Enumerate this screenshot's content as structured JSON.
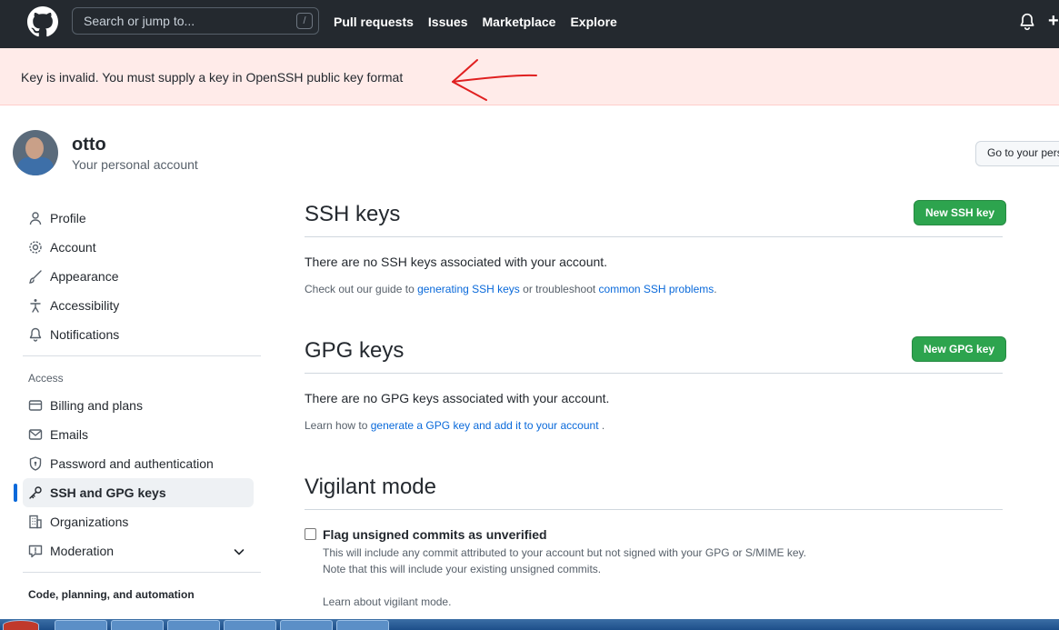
{
  "header": {
    "search_placeholder": "Search or jump to...",
    "slash_hint": "/",
    "nav": [
      "Pull requests",
      "Issues",
      "Marketplace",
      "Explore"
    ],
    "plus": "+"
  },
  "flash": {
    "message": "Key is invalid. You must supply a key in OpenSSH public key format",
    "annotation_color": "#e02020"
  },
  "profile": {
    "username": "otto",
    "subtitle": "Your personal account",
    "goto_button": "Go to your personal profile"
  },
  "sidebar": {
    "items": [
      {
        "label": "Profile",
        "icon": "person-icon"
      },
      {
        "label": "Account",
        "icon": "gear-icon"
      },
      {
        "label": "Appearance",
        "icon": "paintbrush-icon"
      },
      {
        "label": "Accessibility",
        "icon": "accessibility-icon"
      },
      {
        "label": "Notifications",
        "icon": "bell-icon"
      }
    ],
    "access_heading": "Access",
    "access_items": [
      {
        "label": "Billing and plans",
        "icon": "credit-card-icon"
      },
      {
        "label": "Emails",
        "icon": "mail-icon"
      },
      {
        "label": "Password and authentication",
        "icon": "shield-lock-icon"
      },
      {
        "label": "SSH and GPG keys",
        "icon": "key-icon",
        "active": true
      },
      {
        "label": "Organizations",
        "icon": "organization-icon"
      },
      {
        "label": "Moderation",
        "icon": "report-icon"
      }
    ],
    "code_heading": "Code, planning, and automation"
  },
  "ssh": {
    "title": "SSH keys",
    "button": "New SSH key",
    "empty": "There are no SSH keys associated with your account.",
    "help_prefix": "Check out our guide to ",
    "help_link1": "generating SSH keys",
    "help_middle": " or troubleshoot ",
    "help_link2": "common SSH problems",
    "help_suffix": "."
  },
  "gpg": {
    "title": "GPG keys",
    "button": "New GPG key",
    "empty": "There are no GPG keys associated with your account.",
    "help_prefix": "Learn how to ",
    "help_link": "generate a GPG key and add it to your account",
    "help_suffix": " ."
  },
  "vigilant": {
    "title": "Vigilant mode",
    "checkbox_label": "Flag unsigned commits as unverified",
    "checked": false,
    "note1": "This will include any commit attributed to your account but not signed with your GPG or S/MIME key.",
    "note2": "Note that this will include your existing unsigned commits.",
    "learn_link": "Learn about vigilant mode."
  },
  "colors": {
    "header_bg": "#24292f",
    "flash_bg": "#ffebe9",
    "primary_green": "#2da44e",
    "link_blue": "#0969da",
    "active_indicator": "#0969da"
  }
}
